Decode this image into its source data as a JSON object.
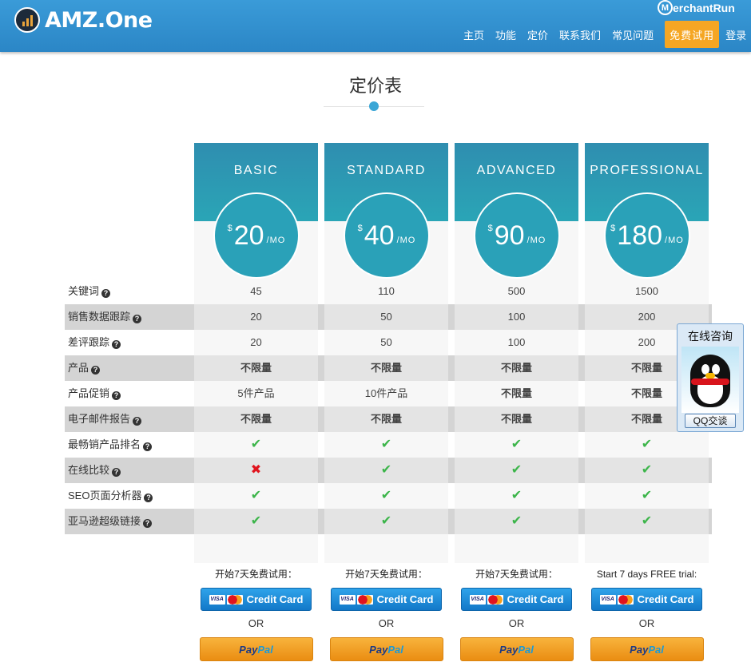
{
  "header": {
    "logo_text": "AMZ.One",
    "partner_logo_text": "MerchantRun",
    "nav": [
      "主页",
      "功能",
      "定价",
      "联系我们",
      "常见问题"
    ],
    "trial_button": "免费试用",
    "login": "登录"
  },
  "title": "定价表",
  "plans": [
    {
      "name": "BASIC",
      "currency": "$",
      "price": "20",
      "per": "/MO"
    },
    {
      "name": "STANDARD",
      "currency": "$",
      "price": "40",
      "per": "/MO"
    },
    {
      "name": "ADVANCED",
      "currency": "$",
      "price": "90",
      "per": "/MO"
    },
    {
      "name": "PROFESSIONAL",
      "currency": "$",
      "price": "180",
      "per": "/MO"
    }
  ],
  "features": [
    {
      "label": "关键词",
      "values": [
        "45",
        "110",
        "500",
        "1500"
      ],
      "style": "text"
    },
    {
      "label": "销售数据跟踪",
      "values": [
        "20",
        "50",
        "100",
        "200"
      ],
      "style": "text"
    },
    {
      "label": "差评跟踪",
      "values": [
        "20",
        "50",
        "100",
        "200"
      ],
      "style": "text"
    },
    {
      "label": "产品",
      "values": [
        "不限量",
        "不限量",
        "不限量",
        "不限量"
      ],
      "style": "bold"
    },
    {
      "label": "产品促销",
      "values": [
        "5件产品",
        "10件产品",
        "不限量",
        "不限量"
      ],
      "style": "mixed"
    },
    {
      "label": "电子邮件报告",
      "values": [
        "不限量",
        "不限量",
        "不限量",
        "不限量"
      ],
      "style": "bold"
    },
    {
      "label": "最畅销产品排名",
      "values": [
        "check",
        "check",
        "check",
        "check"
      ],
      "style": "icon"
    },
    {
      "label": "在线比较",
      "values": [
        "cross",
        "check",
        "check",
        "check"
      ],
      "style": "icon"
    },
    {
      "label": "SEO页面分析器",
      "values": [
        "check",
        "check",
        "check",
        "check"
      ],
      "style": "icon"
    },
    {
      "label": "亚马逊超级链接",
      "values": [
        "check",
        "check",
        "check",
        "check"
      ],
      "style": "icon"
    }
  ],
  "purchase": {
    "trial_texts": [
      "开始7天免费试用：",
      "开始7天免费试用：",
      "开始7天免费试用：",
      "Start 7 days FREE trial:"
    ],
    "credit_card_label": "Credit Card",
    "or_label": "OR",
    "paypal_pay": "Pay",
    "paypal_pal": "Pal",
    "visa_text": "VISA"
  },
  "chat_widget": {
    "title": "在线咨询",
    "button": "QQ交谈"
  },
  "colors": {
    "header": "#2b86c6",
    "plan_header": "#2aa1b8",
    "trial_button": "#f5a623",
    "check": "#3cb54a",
    "cross": "#e0141e"
  }
}
